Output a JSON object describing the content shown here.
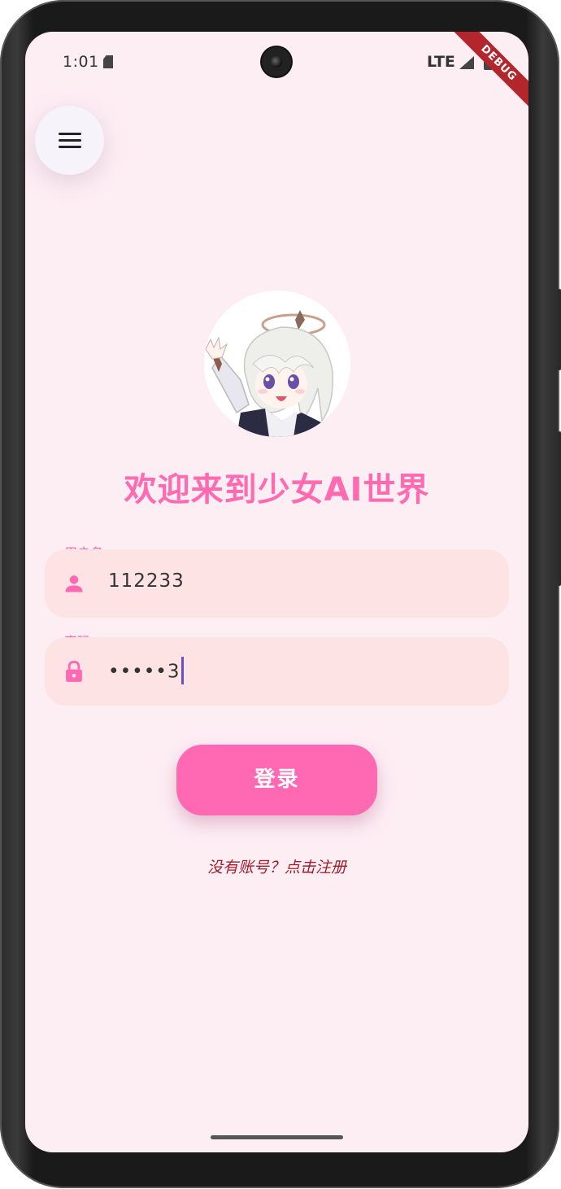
{
  "status_bar": {
    "time": "1:01",
    "network": "LTE",
    "debug_banner": "DEBUG"
  },
  "menu": {
    "icon": "menu-icon"
  },
  "header": {
    "title": "欢迎来到少女AI世界"
  },
  "form": {
    "username": {
      "label": "用户名",
      "value": "112233",
      "icon": "person-icon"
    },
    "password": {
      "label": "密码",
      "value": "•••••3",
      "icon": "lock-icon"
    }
  },
  "actions": {
    "login_label": "登录",
    "register_link": "没有账号？点击注册"
  },
  "colors": {
    "accent": "#ff69b4",
    "background": "#fdeef4",
    "field_fill": "#fde3e3",
    "link": "#a51b2c"
  }
}
